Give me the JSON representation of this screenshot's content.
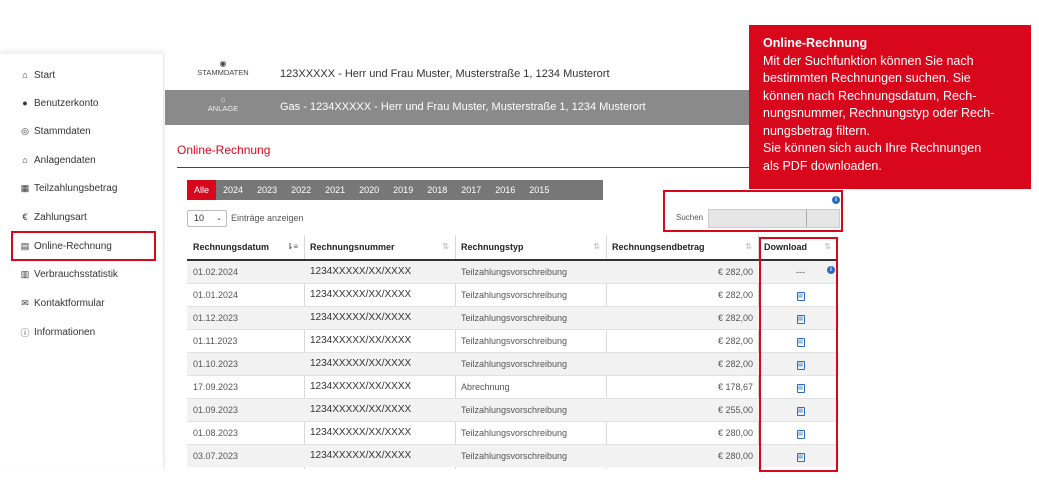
{
  "sidebar": {
    "items": [
      {
        "label": "Start",
        "icon": "home-icon"
      },
      {
        "label": "Benutzerkonto",
        "icon": "user-icon"
      },
      {
        "label": "Stammdaten",
        "icon": "eye-icon"
      },
      {
        "label": "Anlagendaten",
        "icon": "home-icon"
      },
      {
        "label": "Teilzahlungsbetrag",
        "icon": "calculator-icon"
      },
      {
        "label": "Zahlungsart",
        "icon": "euro-icon"
      },
      {
        "label": "Online-Rechnung",
        "icon": "invoice-icon"
      },
      {
        "label": "Verbrauchsstatistik",
        "icon": "bar-chart-icon"
      },
      {
        "label": "Kontaktformular",
        "icon": "envelope-icon"
      },
      {
        "label": "Informationen",
        "icon": "info-icon"
      }
    ]
  },
  "header": {
    "stammdaten_label": "STAMMDATEN",
    "stammdaten_text": "123XXXXX - Herr und Frau Muster, Musterstraße 1, 1234 Musterort",
    "anlage_label": "ANLAGE",
    "anlage_text": "Gas - 1234XXXXX - Herr und Frau Muster, Musterstraße 1, 1234 Musterort"
  },
  "page_title": "Online-Rechnung",
  "year_tabs": [
    "Alle",
    "2024",
    "2023",
    "2022",
    "2021",
    "2020",
    "2019",
    "2018",
    "2017",
    "2016",
    "2015"
  ],
  "controls": {
    "page_length": "10",
    "page_length_label": "Einträge anzeigen",
    "search_label": "Suchen",
    "info_mark": "i"
  },
  "table": {
    "headers": [
      "Rechnungsdatum",
      "Rechnungsnummer",
      "Rechnungstyp",
      "Rechnungsendbetrag",
      "Download"
    ],
    "rows": [
      {
        "date": "01.02.2024",
        "nr": "1234XXXXX/XX/XXXX",
        "type": "Teilzahlungsvorschreibung",
        "amount": "€ 282,00",
        "download": "---"
      },
      {
        "date": "01.01.2024",
        "nr": "1234XXXXX/XX/XXXX",
        "type": "Teilzahlungsvorschreibung",
        "amount": "€ 282,00",
        "download": "pdf"
      },
      {
        "date": "01.12.2023",
        "nr": "1234XXXXX/XX/XXXX",
        "type": "Teilzahlungsvorschreibung",
        "amount": "€ 282,00",
        "download": "pdf"
      },
      {
        "date": "01.11.2023",
        "nr": "1234XXXXX/XX/XXXX",
        "type": "Teilzahlungsvorschreibung",
        "amount": "€ 282,00",
        "download": "pdf"
      },
      {
        "date": "01.10.2023",
        "nr": "1234XXXXX/XX/XXXX",
        "type": "Teilzahlungsvorschreibung",
        "amount": "€ 282,00",
        "download": "pdf"
      },
      {
        "date": "17.09.2023",
        "nr": "1234XXXXX/XX/XXXX",
        "type": "Abrechnung",
        "amount": "€ 178,67",
        "download": "pdf"
      },
      {
        "date": "01.09.2023",
        "nr": "1234XXXXX/XX/XXXX",
        "type": "Teilzahlungsvorschreibung",
        "amount": "€ 255,00",
        "download": "pdf"
      },
      {
        "date": "01.08.2023",
        "nr": "1234XXXXX/XX/XXXX",
        "type": "Teilzahlungsvorschreibung",
        "amount": "€ 280,00",
        "download": "pdf"
      },
      {
        "date": "03.07.2023",
        "nr": "1234XXXXX/XX/XXXX",
        "type": "Teilzahlungsvorschreibung",
        "amount": "€ 280,00",
        "download": "pdf"
      }
    ]
  },
  "callout": {
    "title": "Online-Rechnung",
    "body": "Mit der Suchfunktion können Sie nach\nbestimmten Rechnungen suchen. Sie\nkönnen nach Rechnungsdatum, Rech-\nnungsnummer, Rechnungstyp oder Rech-\nnungsbetrag filtern.\nSie können sich auch Ihre Rechnungen\nals PDF downloaden."
  },
  "colors": {
    "accent": "#d9071c",
    "header_gray": "#8a8a8a",
    "tab_gray": "#777777",
    "info_blue": "#2a6ebb"
  }
}
